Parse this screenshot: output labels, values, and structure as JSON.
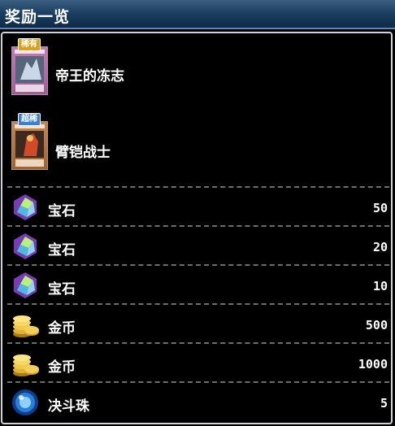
{
  "header": {
    "title": "奖励一览"
  },
  "cards": [
    {
      "name": "帝王的冻志",
      "rarity": "稀有",
      "rarity_color": "#d9a21b",
      "frame_color": "#c67bb6"
    },
    {
      "name": "臂铠战士",
      "rarity": "超稀",
      "rarity_color": "#3a7fd1",
      "frame_color": "#c8864a"
    }
  ],
  "items": [
    {
      "label": "宝石",
      "qty": "50",
      "icon": "gem-icon"
    },
    {
      "label": "宝石",
      "qty": "20",
      "icon": "gem-icon"
    },
    {
      "label": "宝石",
      "qty": "10",
      "icon": "gem-icon"
    },
    {
      "label": "金币",
      "qty": "500",
      "icon": "gold-coin-icon"
    },
    {
      "label": "金币",
      "qty": "1000",
      "icon": "gold-coin-icon"
    },
    {
      "label": "决斗珠",
      "qty": "5",
      "icon": "duel-orb-icon"
    }
  ]
}
